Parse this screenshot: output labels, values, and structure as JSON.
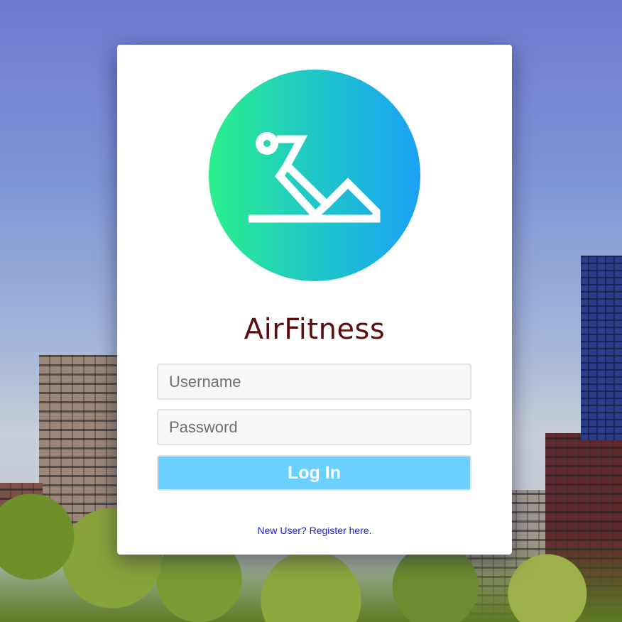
{
  "app": {
    "title": "AirFitness",
    "title_color": "#5b0d10"
  },
  "logo": {
    "icon": "exercise-figure-icon",
    "gradient_start": "#2af08c",
    "gradient_end": "#1aa1f5"
  },
  "form": {
    "username_placeholder": "Username",
    "password_placeholder": "Password",
    "login_label": "Log In",
    "login_color": "#6ad0ff"
  },
  "footer": {
    "register_link": "New User? Register here."
  }
}
